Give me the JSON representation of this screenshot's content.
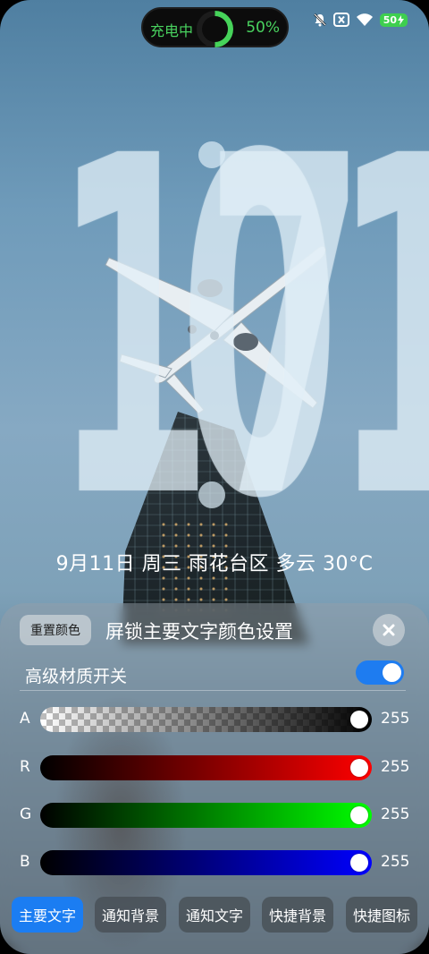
{
  "status_bar": {
    "charging_label": "充电中",
    "charge_percent_text": "50%",
    "charge_level": 0.5,
    "battery_level_text": "50",
    "icons": [
      "mute-bell-icon",
      "no-sim-icon",
      "wifi-icon",
      "battery-charging-icon"
    ]
  },
  "lockscreen": {
    "clock": {
      "hours": "17",
      "minutes": "01"
    },
    "date_line": "9月11日 周三 雨花台区 多云 30°C"
  },
  "panel": {
    "reset_button": "重置颜色",
    "title": "屏锁主要文字颜色设置",
    "close_icon": "close-icon",
    "material_toggle": {
      "label": "高级材质开关",
      "on": true
    },
    "sliders": [
      {
        "channel": "A",
        "value": "255",
        "level": 1.0
      },
      {
        "channel": "R",
        "value": "255",
        "level": 1.0
      },
      {
        "channel": "G",
        "value": "255",
        "level": 1.0
      },
      {
        "channel": "B",
        "value": "255",
        "level": 1.0
      }
    ],
    "tabs": [
      {
        "label": "主要文字",
        "active": true
      },
      {
        "label": "通知背景",
        "active": false
      },
      {
        "label": "通知文字",
        "active": false
      },
      {
        "label": "快捷背景",
        "active": false
      },
      {
        "label": "快捷图标",
        "active": false
      }
    ]
  },
  "colors": {
    "accent": "#1b7df2",
    "charging_green": "#49d25f",
    "battery_green": "#3ecf4f"
  }
}
